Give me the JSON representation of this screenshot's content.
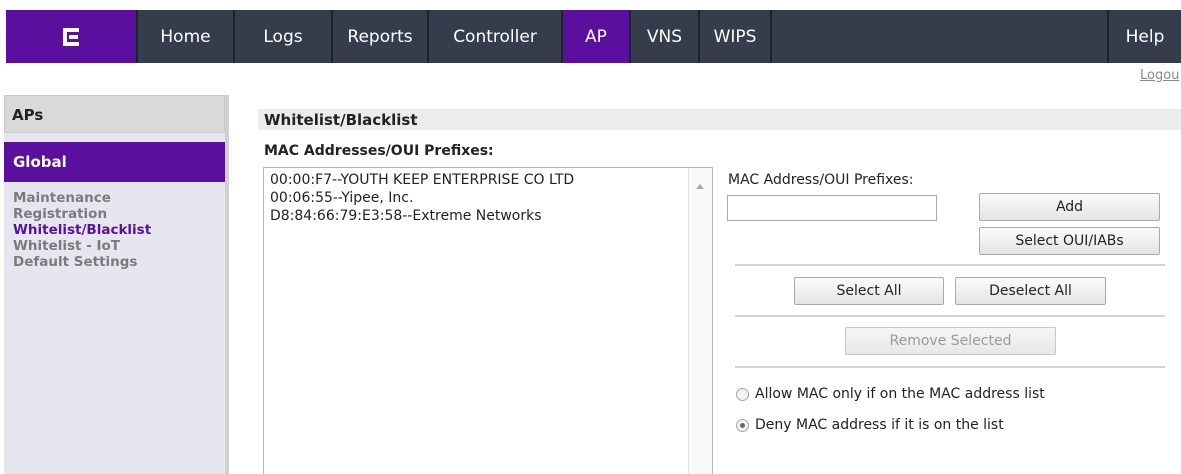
{
  "nav": {
    "tabs": [
      {
        "label": "Home"
      },
      {
        "label": "Logs"
      },
      {
        "label": "Reports"
      },
      {
        "label": "Controller"
      },
      {
        "label": "AP"
      },
      {
        "label": "VNS"
      },
      {
        "label": "WIPS"
      }
    ],
    "help_label": "Help",
    "logout_label": "Logou",
    "colors": {
      "active": "#5a0f9e",
      "bar": "#353d4d"
    }
  },
  "sidebar": {
    "header": "APs",
    "section": "Global",
    "items": [
      {
        "label": "Maintenance"
      },
      {
        "label": "Registration"
      },
      {
        "label": "Whitelist/Blacklist"
      },
      {
        "label": "Whitelist - IoT"
      },
      {
        "label": "Default Settings"
      }
    ]
  },
  "main": {
    "title": "Whitelist/Blacklist",
    "list_caption": "MAC Addresses/OUI Prefixes:",
    "entries": [
      "00:00:F7--YOUTH KEEP ENTERPRISE CO LTD",
      "00:06:55--Yipee, Inc.",
      "D8:84:66:79:E3:58--Extreme Networks"
    ],
    "input_label": "MAC Address/OUI Prefixes:",
    "input_value": "",
    "buttons": {
      "add": "Add",
      "select_oui": "Select OUI/IABs",
      "select_all": "Select All",
      "deselect_all": "Deselect All",
      "remove_selected": "Remove Selected"
    },
    "radios": {
      "allow": "Allow MAC only if on the MAC address list",
      "deny": "Deny MAC address if it is on the list"
    }
  }
}
